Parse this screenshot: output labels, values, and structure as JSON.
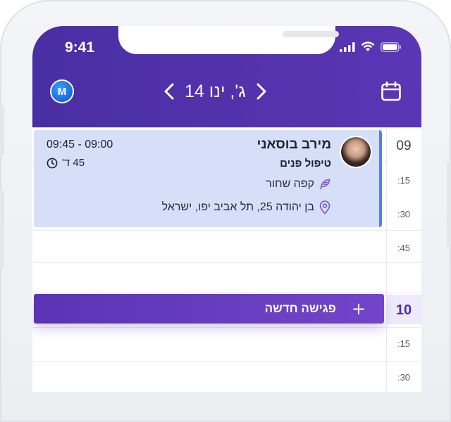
{
  "status_bar": {
    "time": "9:41"
  },
  "header": {
    "user_initial": "M",
    "date_title": "ג', ינו 14"
  },
  "time_labels": {
    "t0900": "09",
    "t0915": ":15",
    "t0930": ":30",
    "t0945": ":45",
    "t1000": "10",
    "t1015": ":15",
    "t1030": ":30"
  },
  "appointment": {
    "client_name": "מירב בוסאני",
    "service": "טיפול פנים",
    "time_range": "09:45 - 09:00",
    "duration": "45 ד'",
    "note": "קפה שחור",
    "address": "בן יהודה 25, תל אביב יפו, ישראל"
  },
  "new_meeting": {
    "label": "פגישה חדשה",
    "plus": "+"
  },
  "colors": {
    "header": "#4a2ea3",
    "appointment_bg": "#d5dff7",
    "appointment_accent": "#5b7ddc",
    "new_meeting": "#6a3cc0"
  }
}
